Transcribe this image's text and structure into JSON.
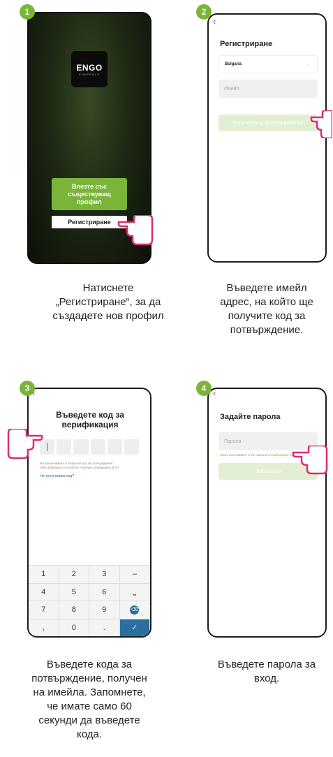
{
  "steps": [
    {
      "badge": "1",
      "caption": [
        "Натиснете",
        "„Регистриране“, за да",
        "създадете нов профил"
      ]
    },
    {
      "badge": "2",
      "caption": [
        "Въведете имейл",
        "адрес, на който ще",
        "получите код за",
        "потвърждение."
      ]
    },
    {
      "badge": "3",
      "caption": [
        "Въведете кода за",
        "потвърждение, получен",
        "на имейла. Запомнете,",
        "че имате само 60",
        "секунди да въведете",
        "кода."
      ]
    },
    {
      "badge": "4",
      "caption": [
        "Въведете парола за",
        "вход."
      ]
    }
  ],
  "screen1": {
    "logo_text": "ENGO",
    "logo_sub": "CONTROLS",
    "login_button": [
      "Влезте със",
      "съществуващ",
      "профил"
    ],
    "register_button": "Регистриране"
  },
  "screen2": {
    "back": "‹",
    "title": "Регистриране",
    "country": "Bulgaria",
    "email_placeholder": "Имейл",
    "get_code_button": "Получете код за потвърждение"
  },
  "screen3": {
    "back": "‹",
    "title_line1": "Въведете код за",
    "title_line2": "верификация",
    "info_line1": "На вашия имейл е изпратен код за потвърждение:",
    "info_line2": "office.bg@salus-controls.eu Повторно изпращане (57s)",
    "no_code_link": "Не получавам код?",
    "keys": [
      "1",
      "2",
      "3",
      "–",
      "4",
      "5",
      "6",
      "⎵",
      "7",
      "8",
      "9",
      "⌫",
      ",",
      "0",
      ".",
      "✓"
    ]
  },
  "screen4": {
    "back": "‹",
    "title": "Задайте парола",
    "password_placeholder": "Парола",
    "hint": "Може използвайте 6-20 символа в комбинация от букви и цифри",
    "done_button": "Завършено"
  },
  "colors": {
    "accent": "#7ab53a",
    "pale_accent": "#e3efd3",
    "key_blue": "#2b6f9e"
  }
}
